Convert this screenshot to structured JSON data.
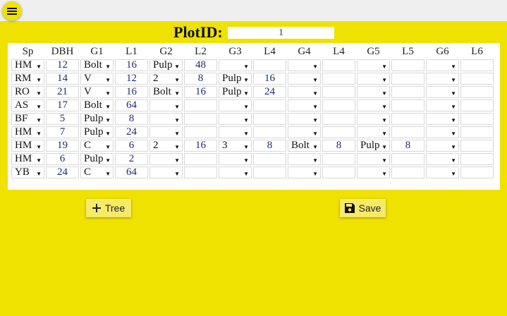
{
  "header": {
    "menu_icon": "hamburger-menu-icon"
  },
  "plot": {
    "label": "PlotID:",
    "value": "1"
  },
  "table": {
    "columns": [
      "Sp",
      "DBH",
      "G1",
      "L1",
      "G2",
      "L2",
      "G3",
      "L4",
      "G4",
      "L4",
      "G5",
      "L5",
      "G6",
      "L6"
    ],
    "rows": [
      [
        "HM",
        "12",
        "Bolt",
        "16",
        "Pulp",
        "48",
        "",
        "",
        "",
        "",
        "",
        "",
        "",
        ""
      ],
      [
        "RM",
        "14",
        "V",
        "12",
        "2",
        "8",
        "Pulp",
        "16",
        "",
        "",
        "",
        "",
        "",
        ""
      ],
      [
        "RO",
        "21",
        "V",
        "16",
        "Bolt",
        "16",
        "Pulp",
        "24",
        "",
        "",
        "",
        "",
        "",
        ""
      ],
      [
        "AS",
        "17",
        "Bolt",
        "64",
        "",
        "",
        "",
        "",
        "",
        "",
        "",
        "",
        "",
        ""
      ],
      [
        "BF",
        "5",
        "Pulp",
        "8",
        "",
        "",
        "",
        "",
        "",
        "",
        "",
        "",
        "",
        ""
      ],
      [
        "HM",
        "7",
        "Pulp",
        "24",
        "",
        "",
        "",
        "",
        "",
        "",
        "",
        "",
        "",
        ""
      ],
      [
        "HM",
        "19",
        "C",
        "6",
        "2",
        "16",
        "3",
        "8",
        "Bolt",
        "8",
        "Pulp",
        "8",
        "",
        ""
      ],
      [
        "HM",
        "6",
        "Pulp",
        "2",
        "",
        "",
        "",
        "",
        "",
        "",
        "",
        "",
        "",
        ""
      ],
      [
        "YB",
        "24",
        "C",
        "64",
        "",
        "",
        "",
        "",
        "",
        "",
        "",
        "",
        "",
        ""
      ]
    ]
  },
  "buttons": {
    "tree_label": "Tree",
    "tree_icon": "plus-icon",
    "save_label": "Save",
    "save_icon": "floppy-disk-icon"
  },
  "colors": {
    "background": "#efe100",
    "button": "#f5ea6a",
    "value_text": "#1e2a78"
  }
}
